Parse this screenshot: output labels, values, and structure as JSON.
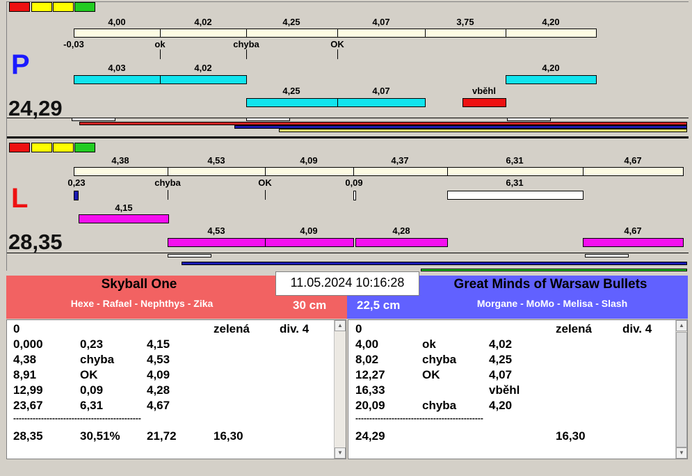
{
  "status_colors": {
    "red": "#ee1111",
    "yellow": "#ffff00",
    "green": "#22cc22"
  },
  "home": {
    "letter": "P",
    "letter_color": "#1a1aff",
    "score": "24,29",
    "durations": [
      "4,00",
      "4,02",
      "4,25",
      "4,07",
      "3,75",
      "4,20"
    ],
    "results": [
      "-0,03",
      "ok",
      "chyba",
      "OK"
    ],
    "lane1": [
      "4,03",
      "4,02",
      "4,20"
    ],
    "lane2": [
      "4,25",
      "4,07"
    ],
    "vbehl": "vběhl"
  },
  "away": {
    "letter": "L",
    "letter_color": "#ee1111",
    "score": "28,35",
    "durations": [
      "4,38",
      "4,53",
      "4,09",
      "4,37",
      "6,31",
      "4,67"
    ],
    "results": [
      "0,23",
      "chyba",
      "OK",
      "0,09",
      "6,31"
    ],
    "lane1": [
      "4,15"
    ],
    "lane2": [
      "4,53",
      "4,09",
      "4,28",
      "4,67"
    ]
  },
  "datetime": "11.05.2024 10:16:28",
  "team_left": {
    "name": "Skyball One",
    "players": "Hexe - Rafael - Nephthys - Zika",
    "height": "30 cm",
    "header": [
      "0",
      "zelená",
      "div. 4"
    ],
    "rows": [
      [
        "0,000",
        "0,23",
        "4,15"
      ],
      [
        "4,38",
        "chyba",
        "4,53"
      ],
      [
        "8,91",
        "OK",
        "4,09"
      ],
      [
        "12,99",
        "0,09",
        "4,28"
      ],
      [
        "23,67",
        "6,31",
        "4,67"
      ]
    ],
    "separator": "----------------------------------------------",
    "total": [
      "28,35",
      "30,51%",
      "21,72",
      "16,30"
    ]
  },
  "team_right": {
    "name": "Great Minds of Warsaw Bullets",
    "players": "Morgane - MoMo - Melisa - Slash",
    "height": "22,5 cm",
    "header": [
      "0",
      "zelená",
      "div. 4"
    ],
    "rows": [
      [
        "4,00",
        "ok",
        "4,02"
      ],
      [
        "8,02",
        "chyba",
        "4,25"
      ],
      [
        "12,27",
        "OK",
        "4,07"
      ],
      [
        "16,33",
        "",
        "vběhl"
      ],
      [
        "20,09",
        "chyba",
        "4,20"
      ]
    ],
    "separator": "----------------------------------------------",
    "total": [
      "24,29",
      "",
      "",
      "16,30"
    ]
  },
  "colors": {
    "left_header": "#f26262",
    "right_header": "#6161ff",
    "cream": "#fdfbe3",
    "cyan": "#11e4ee",
    "magenta": "#f50ff0"
  }
}
